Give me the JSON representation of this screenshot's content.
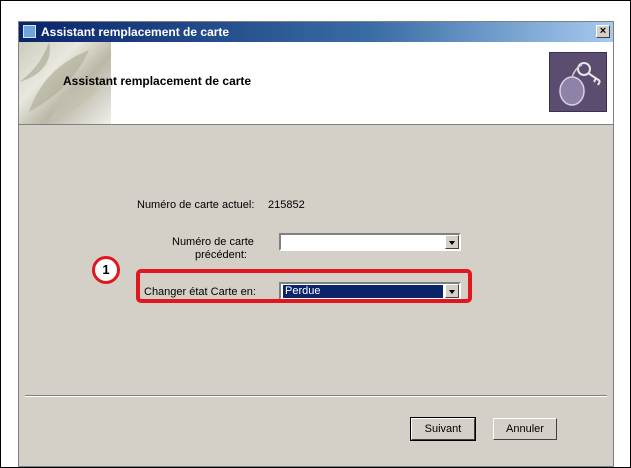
{
  "window": {
    "title": "Assistant remplacement de carte",
    "close_symbol": "×"
  },
  "header": {
    "title": "Assistant remplacement de carte",
    "graphic_icon": "keys-icon"
  },
  "form": {
    "current_card_label": "Numéro de carte actuel:",
    "current_card_value": "215852",
    "previous_card_label_line1": "Numéro de carte",
    "previous_card_label_line2": "précédent:",
    "previous_card_value": "",
    "change_state_label": "Changer état Carte en:",
    "change_state_value": "Perdue"
  },
  "annotation": {
    "step_number": "1"
  },
  "buttons": {
    "next_label": "Suivant",
    "cancel_label": "Annuler"
  },
  "colors": {
    "highlight": "#e0171f",
    "title_bar": "#0a246a",
    "dialog_bg": "#d4d0c8"
  }
}
